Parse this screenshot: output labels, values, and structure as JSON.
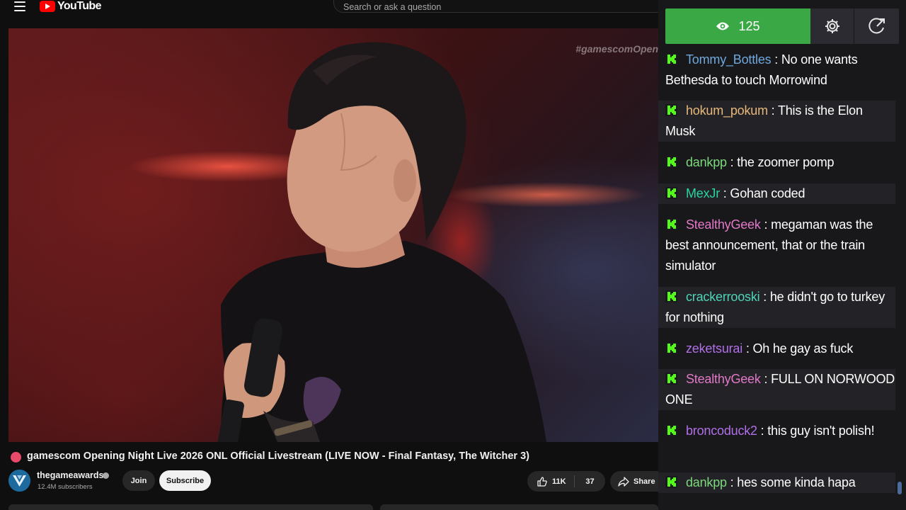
{
  "topbar": {
    "logo_text": "YouTube",
    "search_placeholder": "Search or ask a question"
  },
  "video": {
    "watermark": "#gamescomOpen",
    "title": "gamescom Opening Night Live 2026 ONL Official Livestream (LIVE NOW - Final Fantasy, The Witcher 3)"
  },
  "channel": {
    "name": "thegameawards",
    "subscribers": "12.4M subscribers",
    "join_label": "Join",
    "subscribe_label": "Subscribe"
  },
  "actions": {
    "likes": "11K",
    "dislike_count": "37",
    "share_label": "Share"
  },
  "chat": {
    "viewer_count": "125",
    "messages": [
      {
        "user": "Tommy_Bottles",
        "color": "#6fa8dc",
        "text": "No one wants Bethesda to touch Morrowind"
      },
      {
        "user": "hokum_pokum",
        "color": "#e8b87a",
        "text": "This is the Elon Musk"
      },
      {
        "user": "dankpp",
        "color": "#7cd87c",
        "text": "the zoomer pomp"
      },
      {
        "user": "MexJr",
        "color": "#2bd4a4",
        "text": "Gohan coded"
      },
      {
        "user": "StealthyGeek",
        "color": "#e278c8",
        "text": "megaman was the best announcement, that or the train simulator"
      },
      {
        "user": "crackerrooski",
        "color": "#4ed4b8",
        "text": "he didn't go to turkey for nothing"
      },
      {
        "user": "zeketsurai",
        "color": "#b070e8",
        "text": "Oh he gay as fuck"
      },
      {
        "user": "StealthyGeek",
        "color": "#e278c8",
        "text": "FULL ON NORWOOD ONE"
      },
      {
        "user": "broncoduck2",
        "color": "#b070e8",
        "text": "this guy isn't polish!"
      },
      {
        "user": "dankpp",
        "color": "#7cd87c",
        "text": "hes some kinda hapa"
      }
    ],
    "badge_color": "#53fc18"
  }
}
